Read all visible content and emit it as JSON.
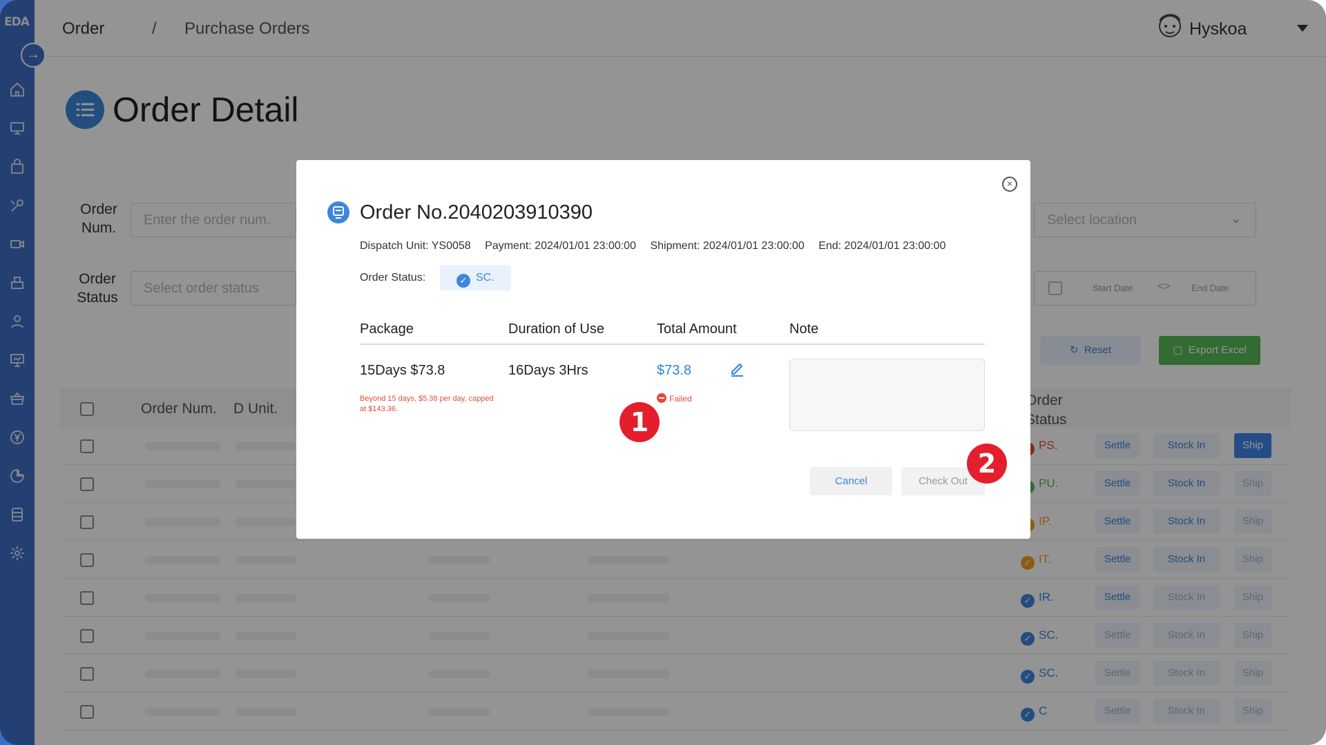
{
  "sidebar": {
    "logo": "EDA",
    "expand_icon": "arrow-right-icon",
    "items": [
      {
        "icon": "home-icon"
      },
      {
        "icon": "monitor-icon"
      },
      {
        "icon": "bag-icon"
      },
      {
        "icon": "tools-icon"
      },
      {
        "icon": "camera-icon"
      },
      {
        "icon": "box-icon"
      },
      {
        "icon": "user-icon"
      },
      {
        "icon": "presentation-icon"
      },
      {
        "icon": "basket-icon"
      },
      {
        "icon": "yen-icon"
      },
      {
        "icon": "chart-icon"
      },
      {
        "icon": "database-icon"
      },
      {
        "icon": "gear-icon"
      }
    ]
  },
  "header": {
    "breadcrumb": [
      "Order",
      "/",
      "Purchase Orders"
    ],
    "user": "Hyskoa"
  },
  "page": {
    "title": "Order Detail",
    "filters": {
      "order_num_label": "Order Num.",
      "order_num_placeholder": "Enter the order num.",
      "order_status_label": "Order Status",
      "order_status_placeholder": "Select order status",
      "location_placeholder": "Select location",
      "start_date": "Start Date",
      "end_date": "End Date"
    },
    "buttons": {
      "reset": "Reset",
      "export": "Export Excel"
    },
    "table": {
      "headers": [
        "Order Num.",
        "D Unit.",
        "Order Status"
      ],
      "rows": [
        {
          "status": "PS.",
          "status_color": "#e5493a",
          "ship_active": true
        },
        {
          "status": "PU.",
          "status_color": "#57b85a",
          "ship_active": false
        },
        {
          "status": "IP.",
          "status_color": "#f0a020",
          "ship_active": false
        },
        {
          "status": "IT.",
          "status_color": "#f0a020",
          "ship_active": false
        },
        {
          "status": "IR.",
          "status_color": "#3d86d9",
          "ship_active": false
        },
        {
          "status": "SC.",
          "status_color": "#3d86d9",
          "ship_active": false
        },
        {
          "status": "SC.",
          "status_color": "#3d86d9",
          "ship_active": false
        },
        {
          "status": "C",
          "status_color": "#3d86d9",
          "ship_active": false
        }
      ],
      "row_actions": {
        "settle": "Settle",
        "stock_in": "Stock In",
        "ship": "Ship"
      }
    }
  },
  "modal": {
    "title": "Order No.2040203910390",
    "dispatch_unit": "Dispatch Unit: YS0058",
    "payment": "Payment: 2024/01/01 23:00:00",
    "shipment": "Shipment: 2024/01/01 23:00:00",
    "end": "End: 2024/01/01 23:00:00",
    "order_status_label": "Order Status:",
    "order_status_value": "SC.",
    "columns": [
      "Package",
      "Duration of Use",
      "Total Amount",
      "Note"
    ],
    "package": "15Days $73.8",
    "package_note": "Beyond 15 days, $5.38 per day, capped at $143.36.",
    "duration": "16Days 3Hrs",
    "total_amount": "$73.8",
    "amount_status": "Failed",
    "cancel": "Cancel",
    "check_out": "Check Out"
  },
  "markers": [
    "1",
    "2"
  ],
  "colors": {
    "accent": "#3d86d9",
    "error": "#e5493a",
    "marker": "#e51e2e",
    "sidebar": "#3f6fc4"
  }
}
